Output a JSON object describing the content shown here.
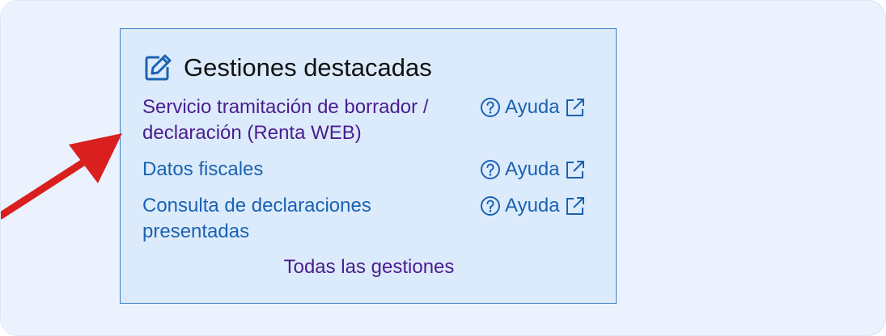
{
  "panel": {
    "title": "Gestiones destacadas",
    "title_icon": "edit-icon",
    "items": [
      {
        "label": "Servicio tramitación de borrador / declaración (Renta WEB)",
        "help_label": "Ayuda",
        "visited": true
      },
      {
        "label": "Datos fiscales",
        "help_label": "Ayuda",
        "visited": false
      },
      {
        "label": "Consulta de declaraciones presentadas",
        "help_label": "Ayuda",
        "visited": false
      }
    ],
    "all_link": "Todas las gestiones"
  },
  "annotation": {
    "arrow_color": "#d9201e"
  },
  "colors": {
    "link": "#1a62b3",
    "visited_link": "#4b1d8e",
    "panel_bg": "#dcebfc",
    "panel_border": "#3a7ec4"
  }
}
